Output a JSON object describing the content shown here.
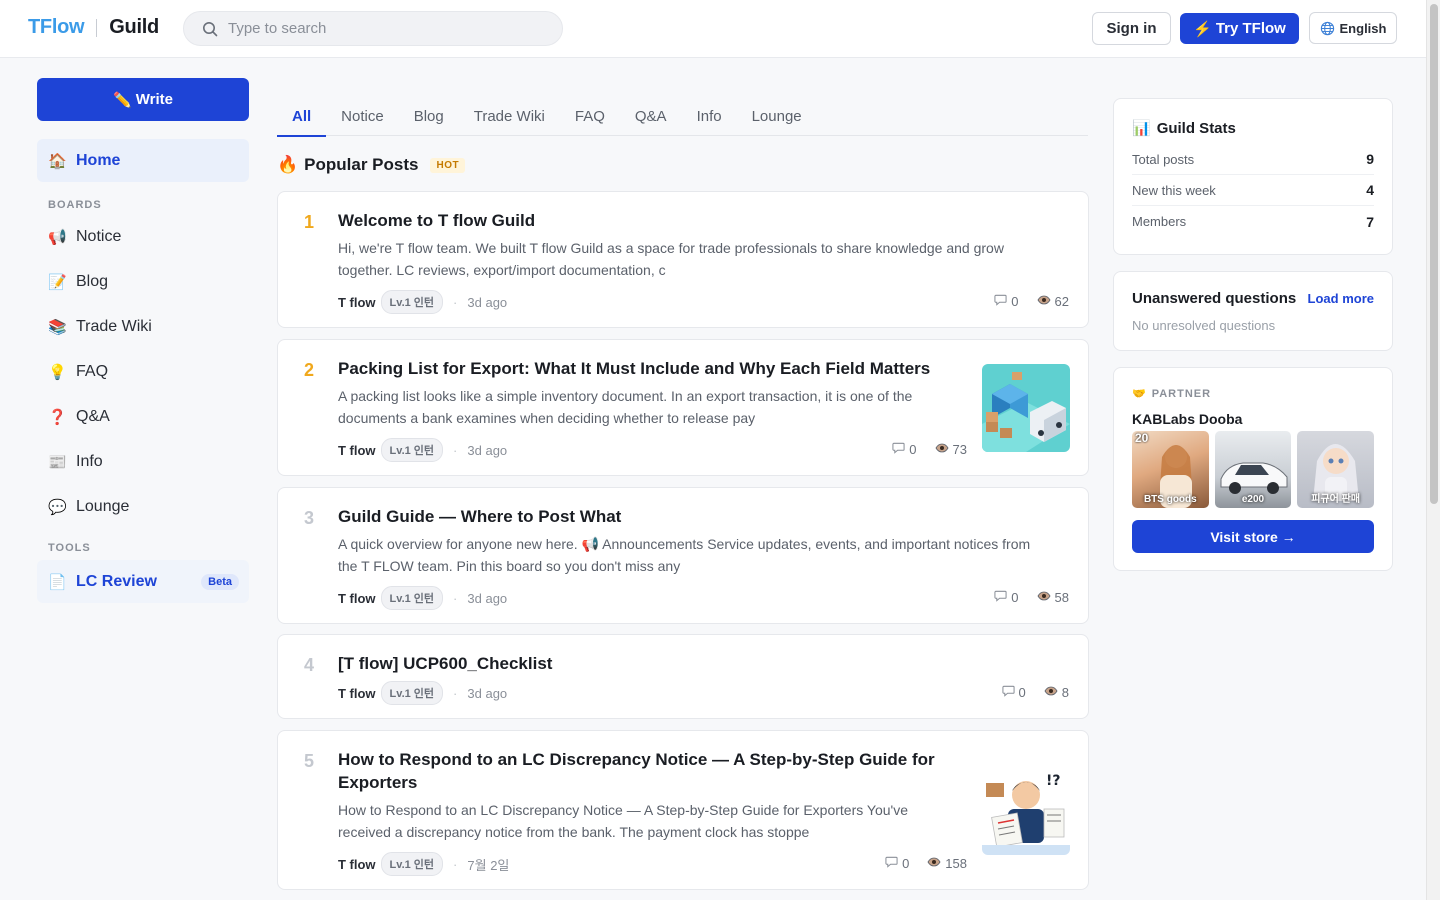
{
  "header": {
    "logo_left": "TFlow",
    "logo_right": "Guild",
    "search_placeholder": "Type to search",
    "sign_in": "Sign in",
    "try_label": "Try TFlow",
    "language": "English"
  },
  "sidebar": {
    "write_label": "Write",
    "home": "Home",
    "boards_label": "BOARDS",
    "boards": [
      {
        "label": "Notice",
        "icon": "megaphone-icon",
        "glyph": "📢"
      },
      {
        "label": "Blog",
        "icon": "memo-icon",
        "glyph": "📝"
      },
      {
        "label": "Trade Wiki",
        "icon": "books-icon",
        "glyph": "📚"
      },
      {
        "label": "FAQ",
        "icon": "lightbulb-icon",
        "glyph": "💡"
      },
      {
        "label": "Q&A",
        "icon": "question-icon",
        "glyph": "❓"
      },
      {
        "label": "Info",
        "icon": "newspaper-icon",
        "glyph": "📰"
      },
      {
        "label": "Lounge",
        "icon": "speech-bubble-icon",
        "glyph": "💬"
      }
    ],
    "tools_label": "TOOLS",
    "lc_review": "LC Review",
    "beta": "Beta"
  },
  "tabs": [
    "All",
    "Notice",
    "Blog",
    "Trade Wiki",
    "FAQ",
    "Q&A",
    "Info",
    "Lounge"
  ],
  "popular": {
    "title": "Popular Posts",
    "badge": "HOT"
  },
  "posts": [
    {
      "rank": "1",
      "title": "Welcome to T flow Guild",
      "excerpt_1": "Hi, we're T flow team. We built T flow Guild as a space for trade professionals to share knowledge and grow",
      "excerpt_2": "together. LC reviews, export/import documentation, c",
      "author": "T flow",
      "level": "Lv.1 인턴",
      "time": "3d ago",
      "comments": "0",
      "views": "62"
    },
    {
      "rank": "2",
      "title": "Packing List for Export: What It Must Include and Why Each Field Matters",
      "excerpt_1": "A packing list looks like a simple inventory document. In an export transaction, it is one of the",
      "excerpt_2": "documents a bank examines when deciding whether to release pay",
      "author": "T flow",
      "level": "Lv.1 인턴",
      "time": "3d ago",
      "comments": "0",
      "views": "73"
    },
    {
      "rank": "3",
      "title": "Guild Guide — Where to Post What",
      "excerpt_1": "A quick overview for anyone new here. 📢 Announcements Service updates, events, and important notices from",
      "excerpt_2": "the T FLOW team. Pin this board so you don't miss any",
      "author": "T flow",
      "level": "Lv.1 인턴",
      "time": "3d ago",
      "comments": "0",
      "views": "58"
    },
    {
      "rank": "4",
      "title": "[T flow] UCP600_Checklist",
      "author": "T flow",
      "level": "Lv.1 인턴",
      "time": "3d ago",
      "comments": "0",
      "views": "8"
    },
    {
      "rank": "5",
      "title_1": "How to Respond to an LC Discrepancy Notice — A Step-by-Step Guide for",
      "title_2": "Exporters",
      "excerpt_1": "How to Respond to an LC Discrepancy Notice — A Step-by-Step Guide for Exporters You've",
      "excerpt_2": "received a discrepancy notice from the bank. The payment clock has stoppe",
      "author": "T flow",
      "level": "Lv.1 인턴",
      "time": "7월 2일",
      "comments": "0",
      "views": "158"
    }
  ],
  "stats": {
    "title": "Guild Stats",
    "rows": [
      {
        "label": "Total posts",
        "value": "9"
      },
      {
        "label": "New this week",
        "value": "4"
      },
      {
        "label": "Members",
        "value": "7"
      }
    ]
  },
  "unanswered": {
    "title": "Unanswered questions",
    "load_more": "Load more",
    "empty": "No unresolved questions"
  },
  "partner": {
    "label": "PARTNER",
    "store": "KABLabs Dooba",
    "products": [
      {
        "caption": "BTS goods",
        "badge": "20"
      },
      {
        "caption": "e200"
      },
      {
        "caption": "피규어 판매"
      }
    ],
    "visit": "Visit store →"
  },
  "colors": {
    "accent": "#1e44d6",
    "logo": "#3b9be8",
    "rank_top": "#f0a81c"
  }
}
